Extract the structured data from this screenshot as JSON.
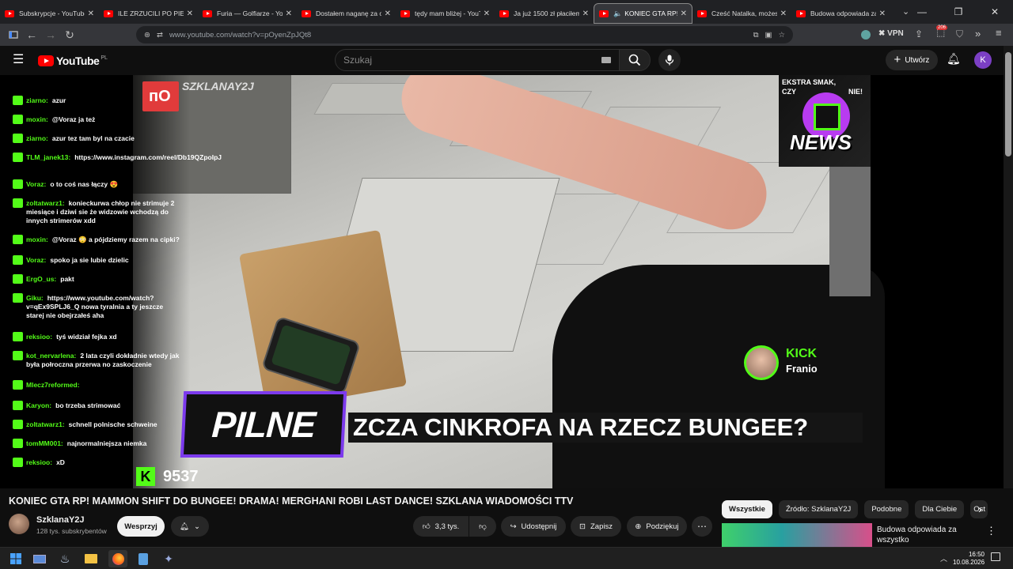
{
  "browser": {
    "tabs": [
      {
        "title": "Subskrypcje - YouTube",
        "active": false
      },
      {
        "title": "ILE ZRZUCILI PO PIERWS",
        "active": false
      },
      {
        "title": "Furia — Golfiarze - YouTu",
        "active": false
      },
      {
        "title": "Dostałem naganę za odr",
        "active": false
      },
      {
        "title": "tędy mam bliżej - YouTu",
        "active": false
      },
      {
        "title": "Ja już 1500 zł płaciłem —",
        "active": false
      },
      {
        "title": "KONIEC GTA RP! MA",
        "active": true
      },
      {
        "title": "Cześć Natalka, możesz w",
        "active": false
      },
      {
        "title": "Budowa odpowiada za w",
        "active": false
      }
    ],
    "url": "www.youtube.com/watch?v=pOyenZpJQt8",
    "vpn_label": "VPN",
    "badge_count": "206"
  },
  "youtube": {
    "logo_text": "YouTube",
    "region": "PL",
    "search_placeholder": "Szukaj",
    "create_label": "Utwórz",
    "account_initial": "K"
  },
  "stream": {
    "brand": "SZKLANAY2J",
    "news_line1": "EKSTRA SMAK,",
    "news_line2": "CZY",
    "news_line3": "NIE!",
    "news_logo": "NEWS",
    "kick_label": "KICK",
    "kick_user": "Franio",
    "pilne": "PILNE",
    "ticker": "ZCZA CINKROFA NA RZECZ BUNGEE?",
    "viewers": "9537",
    "chat": [
      {
        "user": "ziarno:",
        "msg": "azur"
      },
      {
        "user": "moxin:",
        "msg": "@Voraz ja też"
      },
      {
        "user": "ziarno:",
        "msg": "azur tez tam byl na czacie"
      },
      {
        "user": "TLM_janek13:",
        "msg": "https://www.instagram.com/reel/Db19QZpoIpJ"
      },
      {
        "user": "Voraz:",
        "msg": "o to coś nas łączy 😍"
      },
      {
        "user": "zoltatwarz1:",
        "msg": "konieckurwa chłop nie strimuje 2 miesiące i dziwi sie że widzowie wchodzą do innych strimerów xdd"
      },
      {
        "user": "moxin:",
        "msg": "@Voraz 😳 a pójdziemy razem na cipki?"
      },
      {
        "user": "Voraz:",
        "msg": "spoko ja sie lubie dzielic"
      },
      {
        "user": "ErgO_us:",
        "msg": "pakt"
      },
      {
        "user": "Giku:",
        "msg": "https://www.youtube.com/watch?v=qEx9SPLJ6_Q nowa tyralnia a ty jeszcze starej nie obejrzałeś aha"
      },
      {
        "user": "reksioo:",
        "msg": "tyś widział fejka xd"
      },
      {
        "user": "kot_nervarlena:",
        "msg": "2 lata czyli dokładnie wtedy jak była połroczna przerwa no zaskoczenie"
      },
      {
        "user": "Mlecz7reformed:",
        "msg": ""
      },
      {
        "user": "Karyon:",
        "msg": "bo trzeba strimować"
      },
      {
        "user": "zoltatwarz1:",
        "msg": "schnell polnische schweine"
      },
      {
        "user": "tomMM001:",
        "msg": "najnormalniejsza niemka"
      },
      {
        "user": "reksioo:",
        "msg": "xD"
      }
    ]
  },
  "video": {
    "title": "KONIEC GTA RP! MAMMON SHIFT DO BUNGEE! DRAMA! MERGHANI ROBI LAST DANCE! SZKLANA WIADOMOŚCI TTV",
    "channel": "SzklanaY2J",
    "subscribers": "128 tys. subskrybentów",
    "support_label": "Wesprzyj",
    "likes": "3,3 tys.",
    "share_label": "Udostępnij",
    "save_label": "Zapisz",
    "thanks_label": "Podziękuj"
  },
  "sidebar": {
    "chips": [
      "Wszystkie",
      "Źródło: SzklanaY2J",
      "Podobne",
      "Dla Ciebie",
      "Ost"
    ],
    "rec_title": "Budowa odpowiada za wszystko"
  },
  "taskbar": {
    "time": "16:50",
    "date": "10.08.2026"
  }
}
